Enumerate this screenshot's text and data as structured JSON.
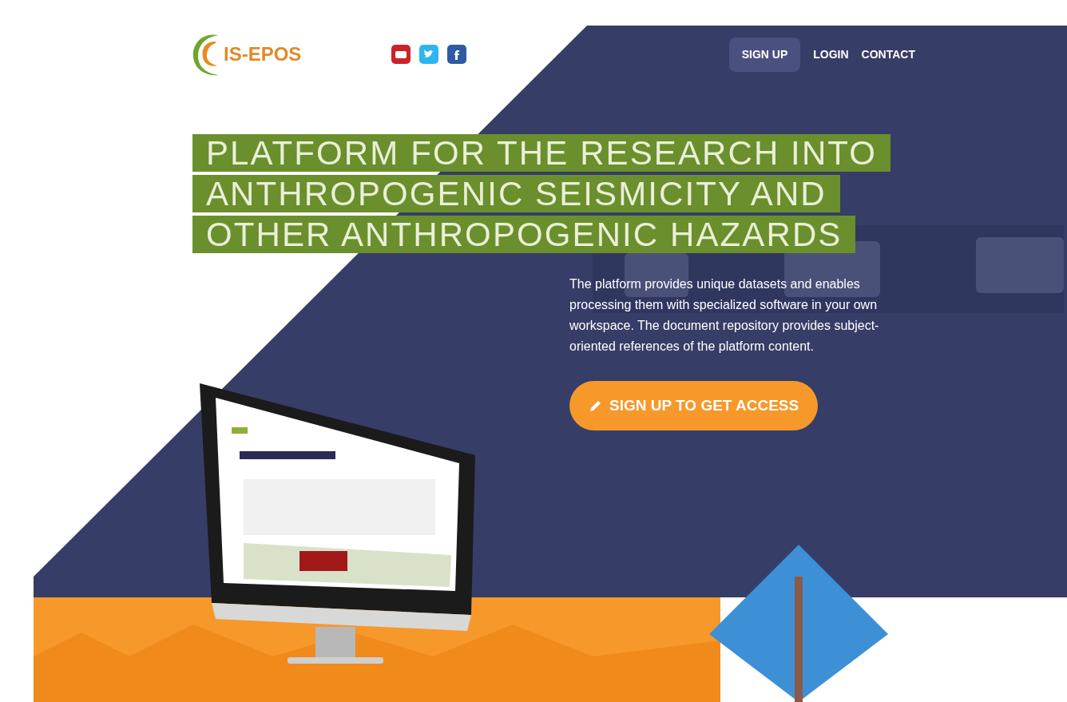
{
  "logo": {
    "text": "IS-EPOS"
  },
  "nav": [
    {
      "label": "SIGN UP",
      "kind": "button"
    },
    {
      "label": "LOGIN",
      "kind": "link"
    },
    {
      "label": "CONTACT",
      "kind": "link"
    }
  ],
  "hero": {
    "headline": "PLATFORM FOR THE RESEARCH INTO ANTHROPOGENIC SEISMICITY AND OTHER ANTHROPOGENIC HAZARDS",
    "description": "The platform provides unique datasets and enables processing them with specialized software in your own workspace. The document repository provides subject-oriented references of the platform content.",
    "cta": "SIGN UP TO GET ACCESS"
  }
}
